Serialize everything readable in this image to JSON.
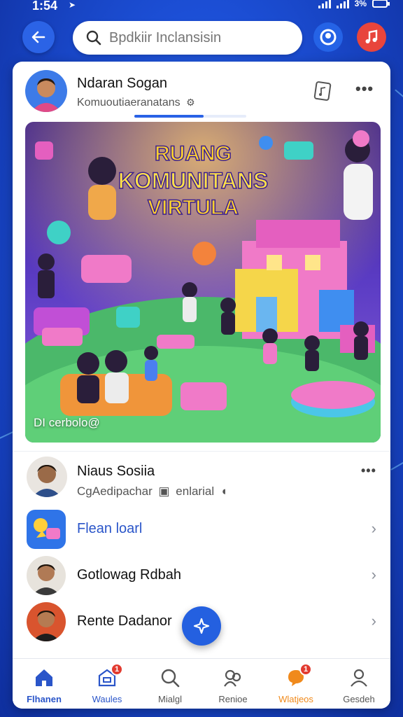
{
  "status_bar": {
    "time": "1:54",
    "battery": "3%"
  },
  "search": {
    "placeholder": "Bpdkiir Inclansisin"
  },
  "post": {
    "author": "Ndaran Sogan",
    "subtitle": "Komuoutiaeranatans",
    "upload_progress": 0.62,
    "image_title_line1": "RUANG",
    "image_title_line2": "KOMUNITANS",
    "image_title_line3": "VIRTULA",
    "image_caption": "DI cerbolo@"
  },
  "list": [
    {
      "name": "Niaus Sosiia",
      "subtitle": "CgAedipachar",
      "extra": "enlarial"
    },
    {
      "name": "Flean loarl"
    },
    {
      "name": "Gotlowag Rdbah"
    },
    {
      "name": "Rente Dadanor"
    }
  ],
  "nav": [
    {
      "label": "Flhanen",
      "color": "#2a55c9"
    },
    {
      "label": "Waules",
      "color": "#2a55c9",
      "badge": "1"
    },
    {
      "label": "Mialgl",
      "color": "#555555"
    },
    {
      "label": "Renioe",
      "color": "#555555"
    },
    {
      "label": "Wlatjeos",
      "color": "#f08a1c",
      "badge": "1"
    },
    {
      "label": "Gesdeh",
      "color": "#555555"
    }
  ],
  "colors": {
    "accent": "#2460e0",
    "notify": "#e23b30",
    "brand_orange": "#f08a1c"
  }
}
